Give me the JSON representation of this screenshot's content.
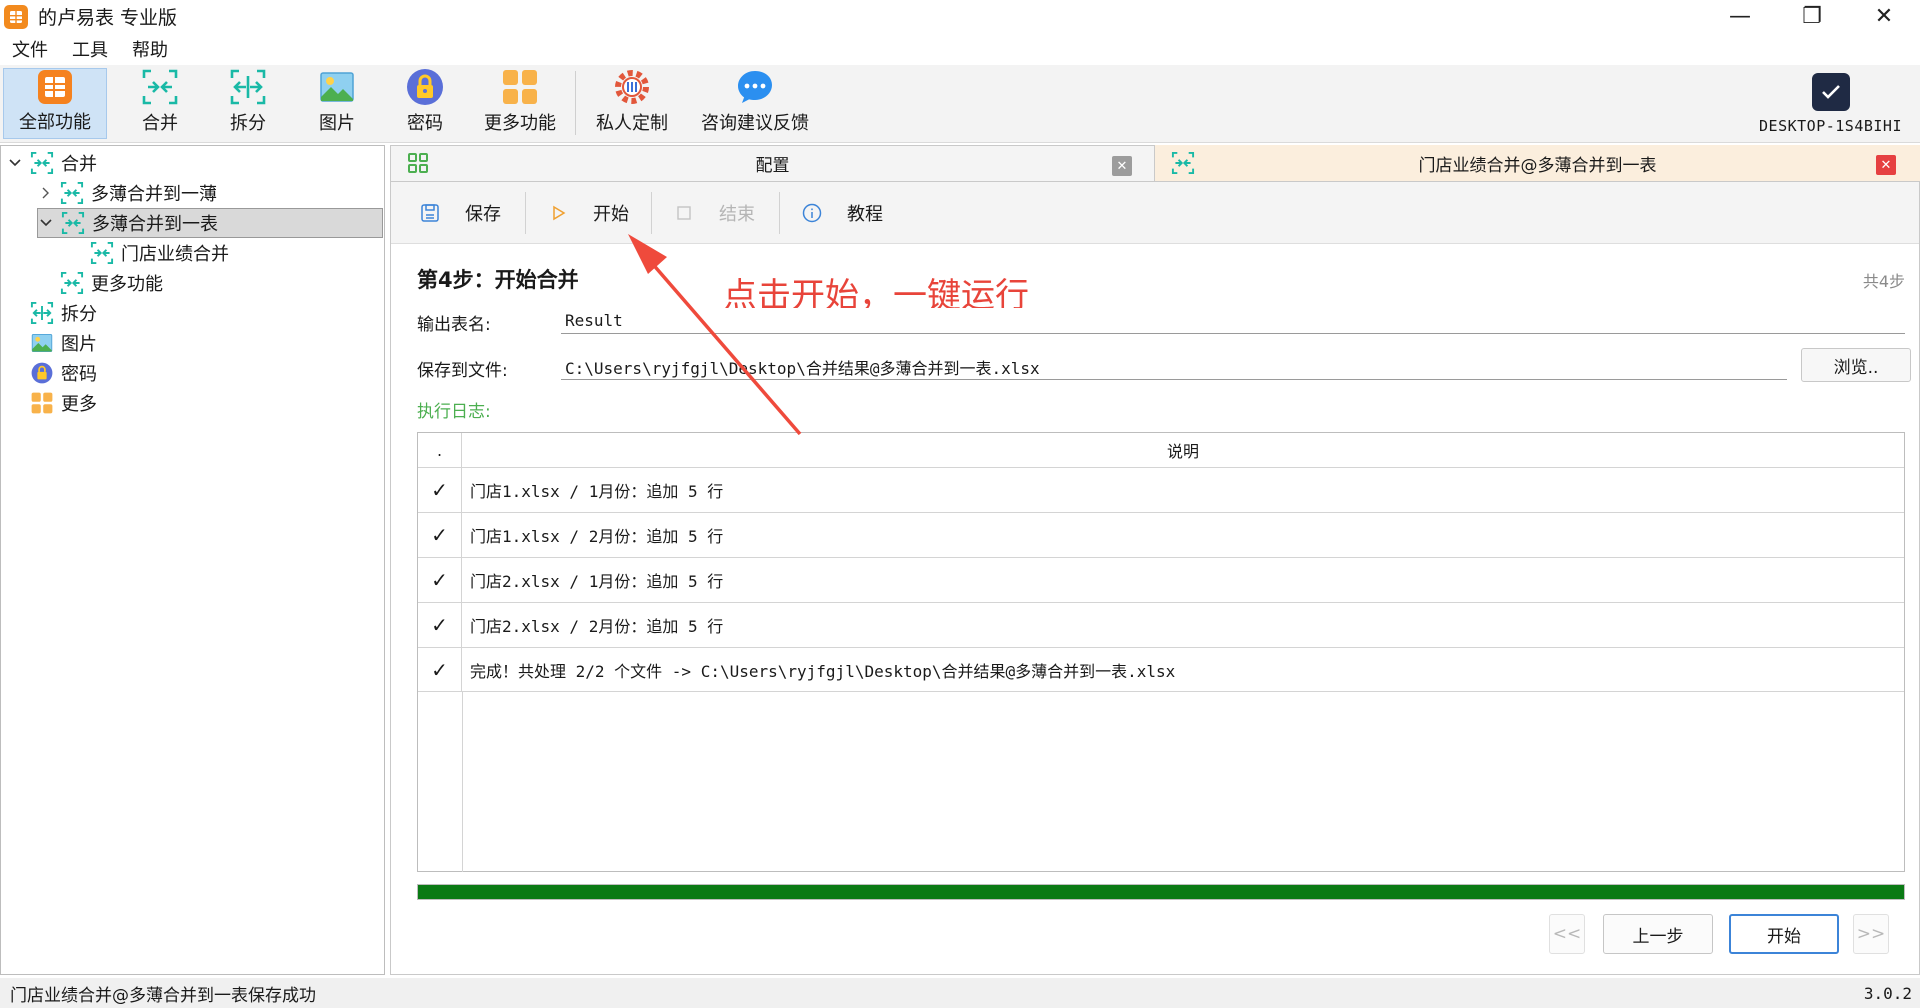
{
  "window": {
    "title": "的卢易表 专业版",
    "minimize": "—",
    "maximize": "❐",
    "close": "✕"
  },
  "menu": [
    "文件",
    "工具",
    "帮助"
  ],
  "ribbon": {
    "all": "全部功能",
    "merge": "合并",
    "split": "拆分",
    "image": "图片",
    "password": "密码",
    "more": "更多功能",
    "custom": "私人定制",
    "feedback": "咨询建议反馈",
    "user": "DESKTOP-1S4BIHI"
  },
  "tree": {
    "merge": "合并",
    "multi_to_book": "多薄合并到一薄",
    "multi_to_sheet": "多薄合并到一表",
    "store_merge": "门店业绩合并",
    "more_functions": "更多功能",
    "split": "拆分",
    "image": "图片",
    "password": "密码",
    "more": "更多"
  },
  "tabs": {
    "config": "配置",
    "job": "门店业绩合并@多薄合并到一表",
    "close_glyph": "✕"
  },
  "toolbar": {
    "save": "保存",
    "start": "开始",
    "stop": "结束",
    "tutorial": "教程"
  },
  "step": {
    "title": "第4步：开始合并",
    "count": "共4步"
  },
  "annotation": "点击开始，一键运行",
  "form": {
    "output_label": "输出表名:",
    "output_value": "Result",
    "save_label": "保存到文件:",
    "save_value": "C:\\Users\\ryjfgjl\\Desktop\\合并结果@多薄合并到一表.xlsx",
    "browse": "浏览..",
    "log_label": "执行日志:"
  },
  "log": {
    "col_status": ".",
    "col_desc": "说明",
    "rows": [
      {
        "mark": "✓",
        "text": "门店1.xlsx / 1月份：追加 5 行"
      },
      {
        "mark": "✓",
        "text": "门店1.xlsx / 2月份：追加 5 行"
      },
      {
        "mark": "✓",
        "text": "门店2.xlsx / 1月份：追加 5 行"
      },
      {
        "mark": "✓",
        "text": "门店2.xlsx / 2月份：追加 5 行"
      },
      {
        "mark": "✓",
        "text": "完成！共处理 2/2 个文件 -> C:\\Users\\ryjfgjl\\Desktop\\合并结果@多薄合并到一表.xlsx"
      }
    ]
  },
  "progress": {
    "percent": 100,
    "color": "#0a7a14"
  },
  "nav": {
    "first": "<<",
    "prev": "上一步",
    "start": "开始",
    "last": ">>"
  },
  "status": {
    "message": "门店业绩合并@多薄合并到一表保存成功",
    "version": "3.0.2"
  },
  "colors": {
    "accent": "#3c84d8",
    "annotation": "#e8443a",
    "merge_icon": "#19b9a6"
  }
}
